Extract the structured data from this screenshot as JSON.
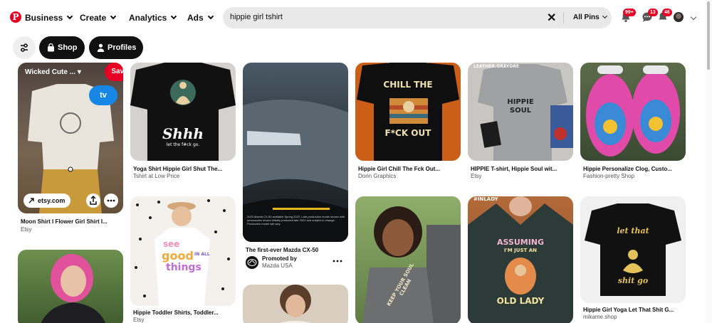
{
  "nav": {
    "business": "Business",
    "create": "Create",
    "analytics": "Analytics",
    "ads": "Ads"
  },
  "search": {
    "query": "hippie girl tshirt",
    "scope": "All Pins"
  },
  "badges": {
    "notifications": "99+",
    "messages": "13",
    "updates": "46"
  },
  "filters": {
    "shop": "Shop",
    "profiles": "Profiles"
  },
  "pins": [
    {
      "title": "Moon Shirt I Flower Girl Shirt I...",
      "source": "Etsy"
    },
    {
      "title": "Yoga Shirt Hippie Girl Shut The...",
      "source": "Tshirt at Low Price"
    },
    {
      "title": "The first-ever Mazda CX-50",
      "source": "Promoted by",
      "advertiser": "Mazda USA"
    },
    {
      "title": "Hippie Girl Chill The Fck Out...",
      "source": "Dorin Graphics"
    },
    {
      "title": "HIPPIE T-shirt, Hippie Soul wit...",
      "source": "Etsy"
    },
    {
      "title": "Hippie Personalize Clog, Custo...",
      "source": "Fashion-pretty Shop"
    },
    {
      "title": "Hippie Toddler Shirts, Toddler...",
      "source": "Etsy"
    },
    {
      "title": "Hippie Girl Yoga Let That Shit G...",
      "source": "mikame.shop"
    }
  ],
  "hover_pin": {
    "board": "Wicked Cute ...",
    "save": "Save",
    "link": "etsy.com",
    "tv": "tv"
  },
  "artwork": {
    "shhh": "Shhh",
    "shhh_sub": "let the f#ck go.",
    "chill_top": "CHILL THE",
    "chill_bottom": "F*CK OUT",
    "leather": "LEATHER.GRAYDRE",
    "hippie": "HIPPIE",
    "soul": "SOUL",
    "see": "see",
    "good": "good",
    "in_all": "IN ALL",
    "things": "things",
    "assuming": "ASSUMING",
    "im_just_an": "I'M JUST AN",
    "old_lady": "OLD LADY",
    "let_that": "let that",
    "shit_go": "shit go",
    "keep_your_soul": "KEEP YOUR SOUL CLEAN",
    "inlady": "#INLADY",
    "mazda_fine": "2023 Mazda CX-50 available Spring 2022. Late-production model shown with accessories shown Initially produced late 2022 and subject to change. Production model will vary."
  },
  "colors": {
    "brand_red": "#e60023",
    "tv_blue": "#1787e5",
    "pill_black": "#111111",
    "search_bg": "#e9e9e9"
  }
}
